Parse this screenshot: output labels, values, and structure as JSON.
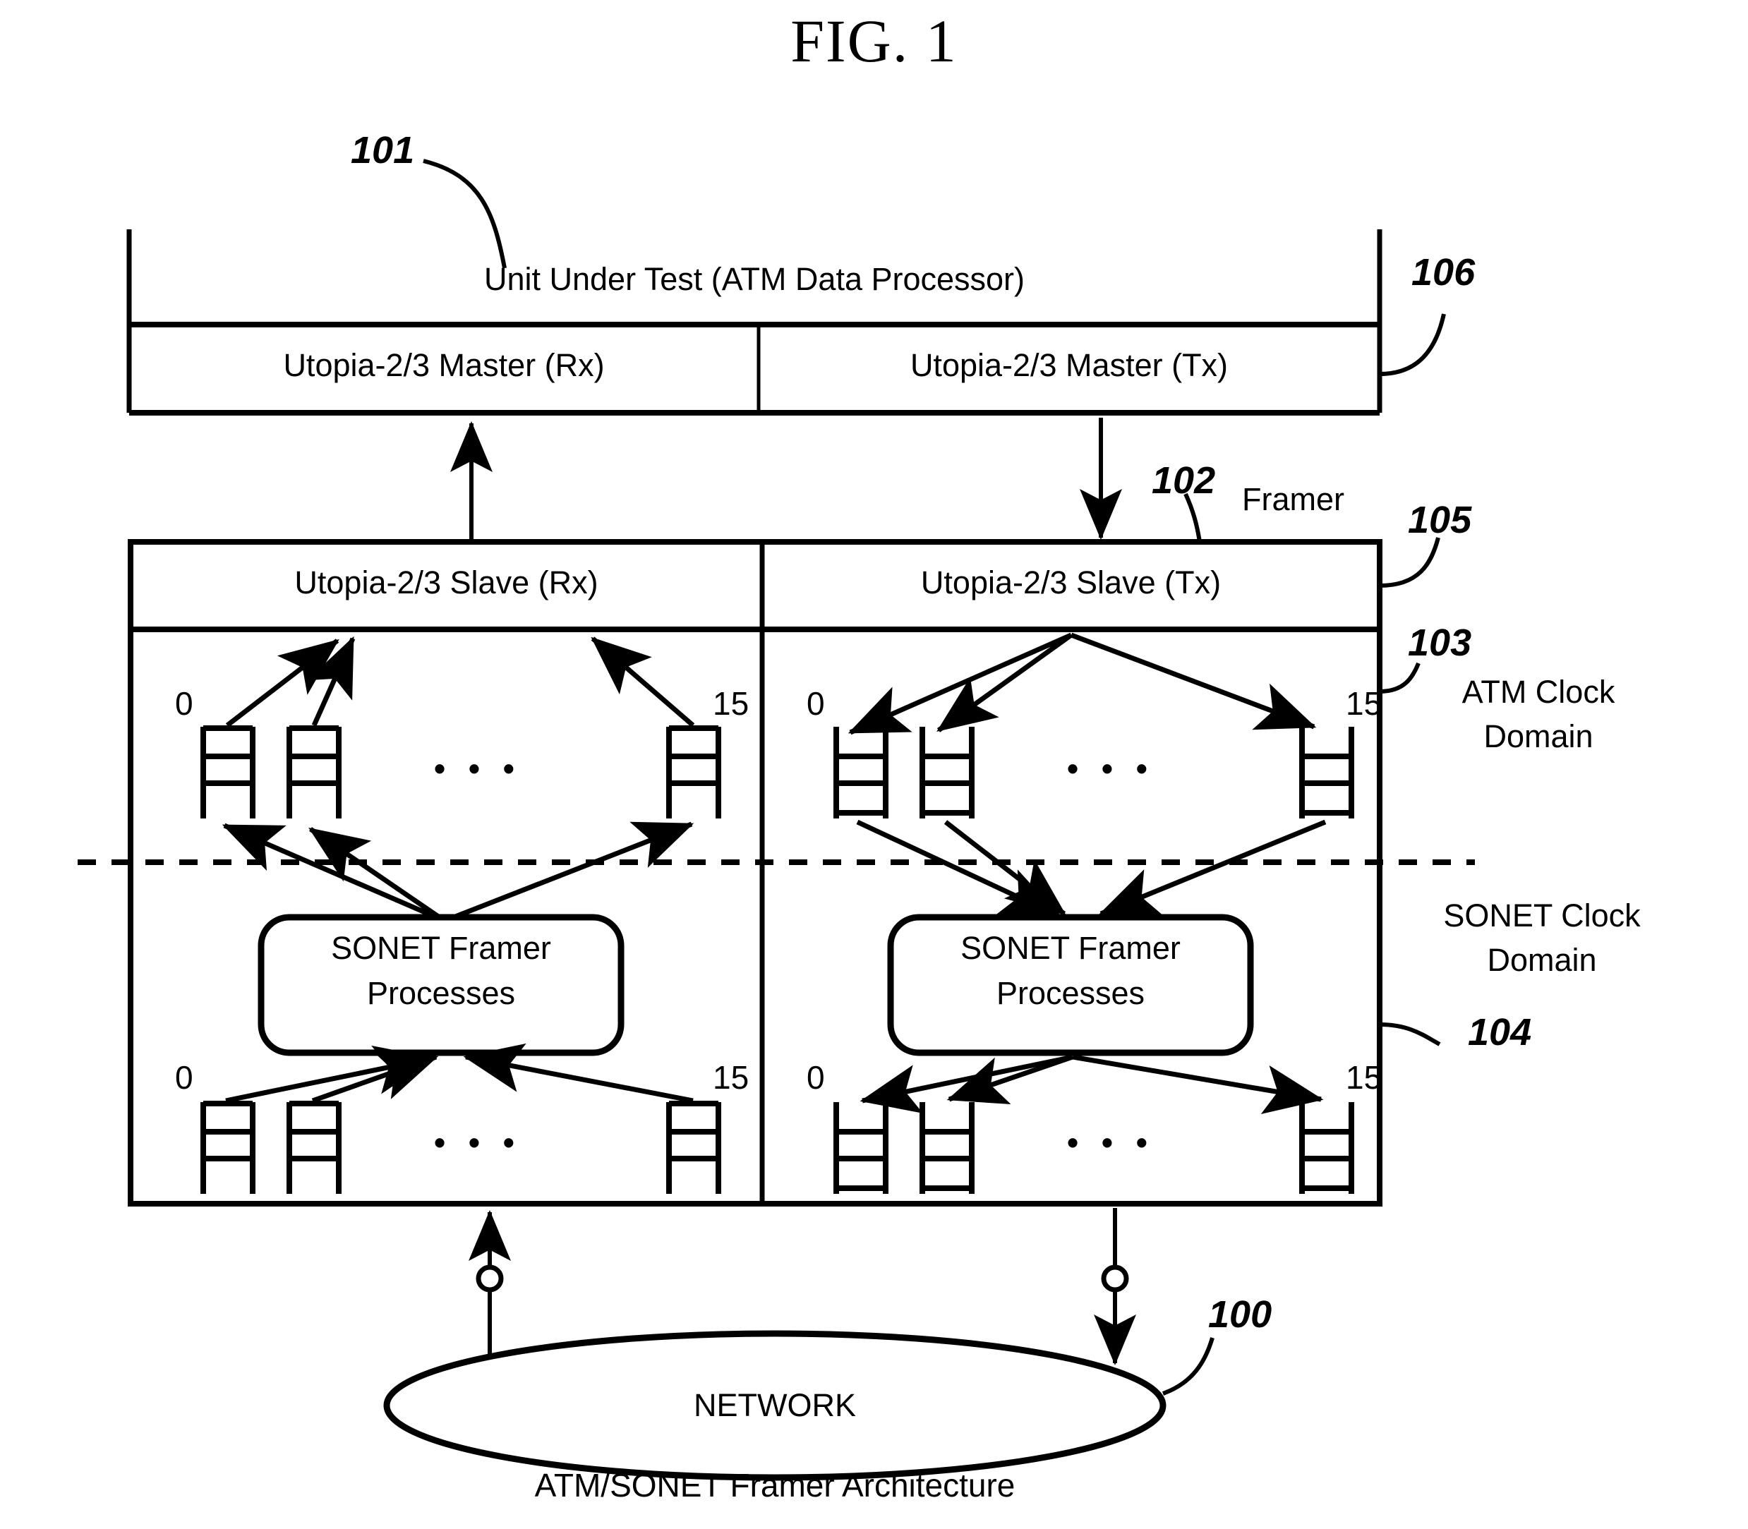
{
  "figure": {
    "title": "FIG. 1",
    "caption": "ATM/SONET Framer Architecture"
  },
  "uut": {
    "title": "Unit Under Test (ATM Data Processor)",
    "ref": "101",
    "ports": [
      {
        "label": "Utopia-2/3 Master (Rx)"
      },
      {
        "label": "Utopia-2/3 Master (Tx)",
        "ref": "106"
      }
    ]
  },
  "framer": {
    "label": "Framer",
    "ref": "102",
    "ports": [
      {
        "label": "Utopia-2/3 Slave (Rx)"
      },
      {
        "label": "Utopia-2/3 Slave (Tx)",
        "ref": "105"
      }
    ],
    "process_block_label_line1": "SONET Framer",
    "process_block_label_line2": "Processes",
    "fifo_first_index": "0",
    "fifo_last_index": "15",
    "ellipsis": "• • •"
  },
  "clock_domains": [
    {
      "line1": "ATM Clock",
      "line2": "Domain",
      "ref": "103"
    },
    {
      "line1": "SONET Clock",
      "line2": "Domain",
      "ref": "104"
    }
  ],
  "network": {
    "label": "NETWORK",
    "ref": "100"
  },
  "colors": {
    "ink": "#000000",
    "paper": "#ffffff"
  }
}
